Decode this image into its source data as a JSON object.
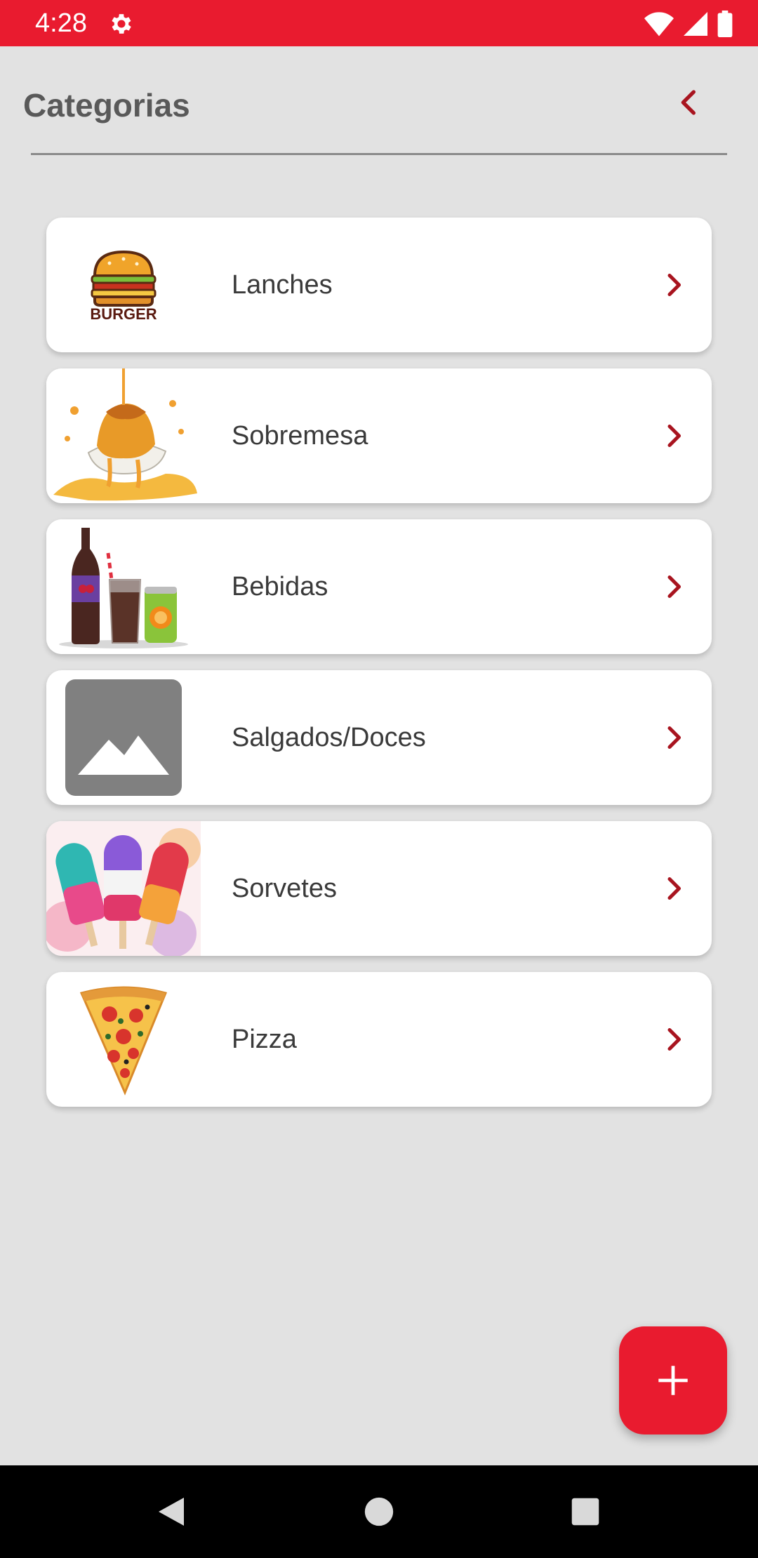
{
  "status_bar": {
    "time": "4:28",
    "icons": [
      "gear-icon",
      "wifi-icon",
      "signal-icon",
      "battery-icon"
    ]
  },
  "header": {
    "title": "Categorias",
    "back_icon": "chevron-left-icon"
  },
  "categories": [
    {
      "label": "Lanches",
      "thumb": "burger-image",
      "thumb_text": "BURGER"
    },
    {
      "label": "Sobremesa",
      "thumb": "dessert-image"
    },
    {
      "label": "Bebidas",
      "thumb": "drinks-image"
    },
    {
      "label": "Salgados/Doces",
      "thumb": "image-placeholder-icon"
    },
    {
      "label": "Sorvetes",
      "thumb": "popsicles-image"
    },
    {
      "label": "Pizza",
      "thumb": "pizza-image"
    }
  ],
  "fab": {
    "icon": "plus-icon"
  },
  "nav_bar": {
    "buttons": [
      "back-nav-icon",
      "home-nav-icon",
      "recents-nav-icon"
    ]
  },
  "colors": {
    "accent": "#e91b2f",
    "chevron": "#a8141f",
    "background": "#e2e2e2",
    "card": "#ffffff",
    "title": "#595959"
  }
}
